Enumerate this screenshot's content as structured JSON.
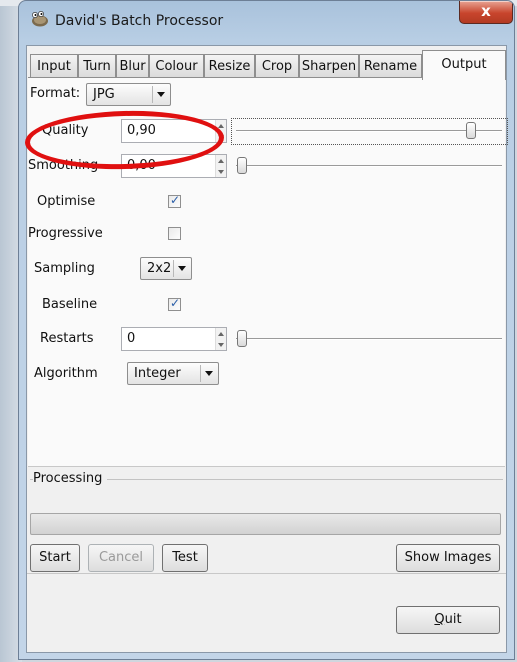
{
  "window": {
    "title": "David's Batch Processor",
    "close_glyph": "x"
  },
  "tabs": [
    {
      "label": "Input",
      "active": false
    },
    {
      "label": "Turn",
      "active": false
    },
    {
      "label": "Blur",
      "active": false
    },
    {
      "label": "Colour",
      "active": false
    },
    {
      "label": "Resize",
      "active": false
    },
    {
      "label": "Crop",
      "active": false
    },
    {
      "label": "Sharpen",
      "active": false
    },
    {
      "label": "Rename",
      "active": false
    },
    {
      "label": "Output",
      "active": true
    }
  ],
  "output": {
    "format": {
      "label": "Format:",
      "value": "JPG"
    },
    "quality": {
      "label": "Quality",
      "value": "0,90",
      "slider_fraction": 0.9
    },
    "smoothing": {
      "label": "Smoothing",
      "value": "0,00",
      "slider_fraction": 0.0
    },
    "optimise": {
      "label": "Optimise",
      "checked": true
    },
    "progressive": {
      "label": "Progressive",
      "checked": false
    },
    "sampling": {
      "label": "Sampling",
      "value": "2x2"
    },
    "baseline": {
      "label": "Baseline",
      "checked": true
    },
    "restarts": {
      "label": "Restarts",
      "value": "0",
      "slider_fraction": 0.0
    },
    "algorithm": {
      "label": "Algorithm",
      "value": "Integer"
    }
  },
  "processing": {
    "label": "Processing",
    "progress_fraction": 0.0
  },
  "buttons": {
    "start": "Start",
    "cancel": "Cancel",
    "test": "Test",
    "show_images": "Show Images",
    "quit": "Quit"
  },
  "colors": {
    "annotation": "#e01010",
    "check_mark": "#2a5ea8",
    "close_button": "#c8452d"
  },
  "icons": {
    "app": "gimp-wilber-icon",
    "check": "checkmark"
  }
}
